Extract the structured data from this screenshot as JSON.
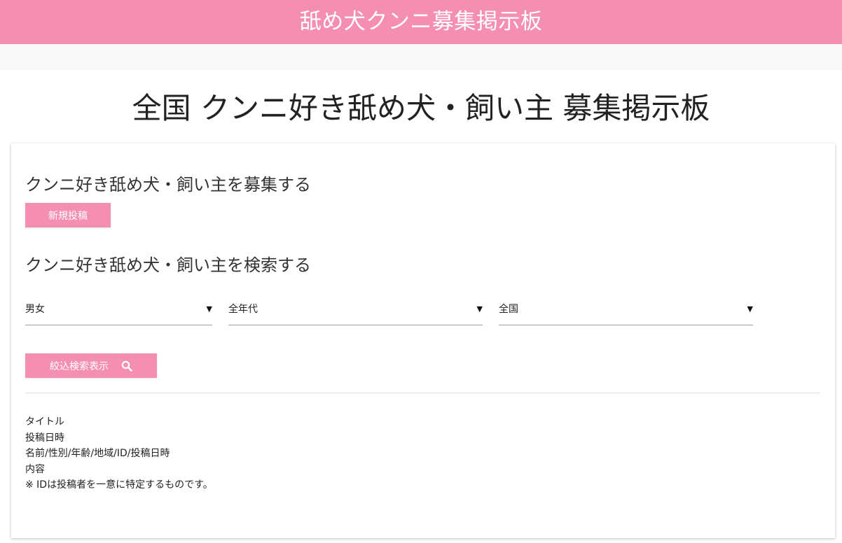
{
  "header": {
    "site_title": "舐め犬クンニ募集掲示板",
    "brand_color": "#f48fb1"
  },
  "page": {
    "title": "全国 クンニ好き舐め犬・飼い主 募集掲示板"
  },
  "post_section": {
    "heading": "クンニ好き舐め犬・飼い主を募集する",
    "new_post_button": "新規投稿"
  },
  "search_section": {
    "heading": "クンニ好き舐め犬・飼い主を検索する",
    "filters": {
      "gender": "男女",
      "age": "全年代",
      "area": "全国"
    },
    "search_button": "絞込検索表示",
    "search_icon": "search-icon"
  },
  "info": {
    "lines": [
      "タイトル",
      "投稿日時",
      "名前/性別/年齢/地域/ID/投稿日時",
      "内容",
      "※ IDは投稿者を一意に特定するものです。"
    ]
  }
}
